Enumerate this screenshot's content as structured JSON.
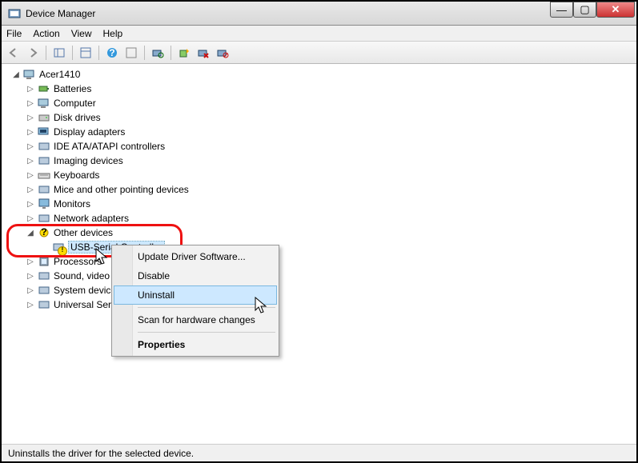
{
  "title": "Device Manager",
  "menus": [
    "File",
    "Action",
    "View",
    "Help"
  ],
  "root": "Acer1410",
  "categories": [
    {
      "label": "Batteries",
      "expand": "▷"
    },
    {
      "label": "Computer",
      "expand": "▷"
    },
    {
      "label": "Disk drives",
      "expand": "▷"
    },
    {
      "label": "Display adapters",
      "expand": "▷"
    },
    {
      "label": "IDE ATA/ATAPI controllers",
      "expand": "▷"
    },
    {
      "label": "Imaging devices",
      "expand": "▷"
    },
    {
      "label": "Keyboards",
      "expand": "▷"
    },
    {
      "label": "Mice and other pointing devices",
      "expand": "▷"
    },
    {
      "label": "Monitors",
      "expand": "▷"
    },
    {
      "label": "Network adapters",
      "expand": "▷"
    },
    {
      "label": "Other devices",
      "expand": "◢",
      "children": [
        {
          "label": "USB-Serial Controller",
          "warning": true,
          "selected": true
        }
      ]
    },
    {
      "label": "Processors",
      "expand": "▷"
    },
    {
      "label": "Sound, video and game controllers",
      "expand": "▷"
    },
    {
      "label": "System devices",
      "expand": "▷"
    },
    {
      "label": "Universal Serial Bus controllers",
      "expand": "▷"
    }
  ],
  "context_menu": {
    "items": [
      {
        "label": "Update Driver Software..."
      },
      {
        "label": "Disable"
      },
      {
        "label": "Uninstall",
        "highlight": true
      },
      {
        "sep": true
      },
      {
        "label": "Scan for hardware changes"
      },
      {
        "sep": true
      },
      {
        "label": "Properties",
        "bold": true
      }
    ]
  },
  "status": "Uninstalls the driver for the selected device.",
  "win_buttons": {
    "min": "—",
    "max": "▢",
    "close": "✕"
  }
}
